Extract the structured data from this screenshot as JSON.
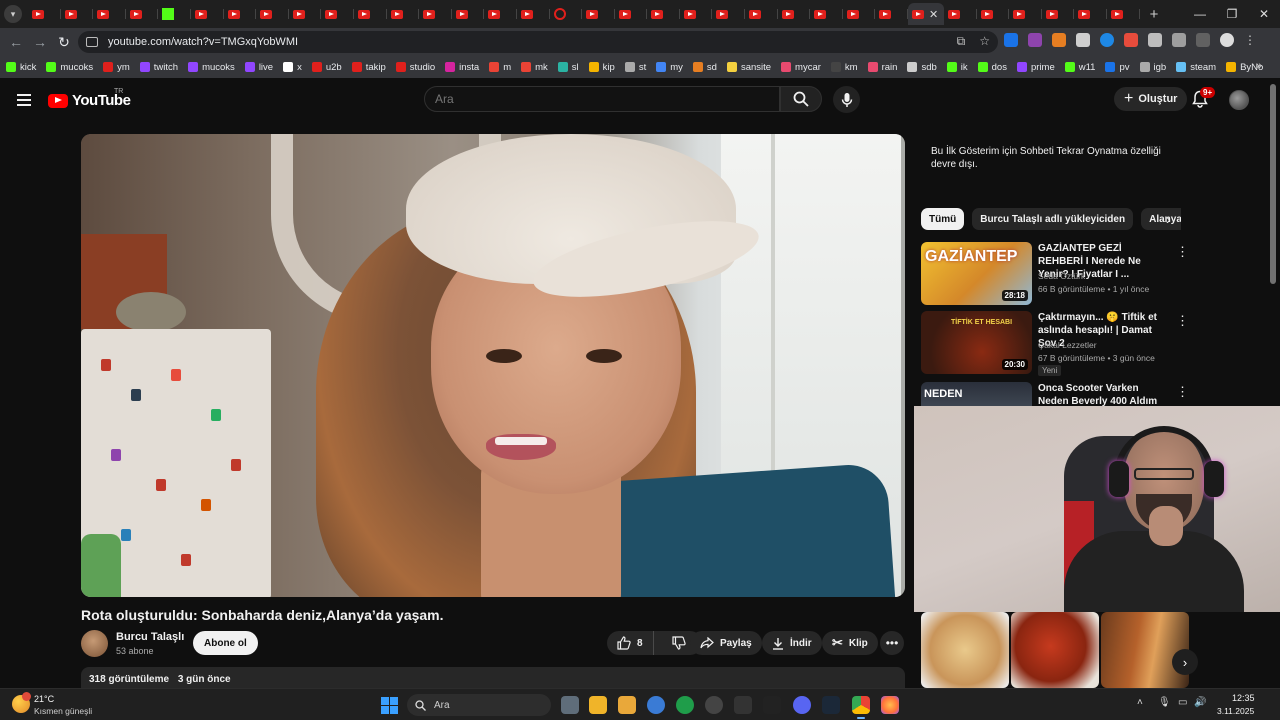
{
  "browser": {
    "url": "youtube.com/watch?v=TMGxqYobWMI",
    "bookmarks": [
      {
        "label": "kick",
        "color": "#53fc18"
      },
      {
        "label": "mucoks",
        "color": "#53fc18"
      },
      {
        "label": "ym",
        "color": "#e0201c"
      },
      {
        "label": "twitch",
        "color": "#9146ff"
      },
      {
        "label": "mucoks",
        "color": "#9146ff"
      },
      {
        "label": "live",
        "color": "#9146ff"
      },
      {
        "label": "x",
        "color": "#ffffff"
      },
      {
        "label": "u2b",
        "color": "#e0201c"
      },
      {
        "label": "takip",
        "color": "#e0201c"
      },
      {
        "label": "studio",
        "color": "#e0201c"
      },
      {
        "label": "insta",
        "color": "#d6249f"
      },
      {
        "label": "m",
        "color": "#ea4335"
      },
      {
        "label": "mk",
        "color": "#ea4335"
      },
      {
        "label": "sl",
        "color": "#2bb3a3"
      },
      {
        "label": "kip",
        "color": "#f4b400"
      },
      {
        "label": "st",
        "color": "#aaaaaa"
      },
      {
        "label": "my",
        "color": "#4285f4"
      },
      {
        "label": "sd",
        "color": "#e67e22"
      },
      {
        "label": "sansite",
        "color": "#f4d03f"
      },
      {
        "label": "mycar",
        "color": "#e84a6f"
      },
      {
        "label": "km",
        "color": "#444444"
      },
      {
        "label": "rain",
        "color": "#e84a6f"
      },
      {
        "label": "sdb",
        "color": "#cccccc"
      },
      {
        "label": "ik",
        "color": "#53fc18"
      },
      {
        "label": "dos",
        "color": "#53fc18"
      },
      {
        "label": "prime",
        "color": "#9146ff"
      },
      {
        "label": "w11",
        "color": "#53fc18"
      },
      {
        "label": "pv",
        "color": "#1a73e8"
      },
      {
        "label": "igb",
        "color": "#aaaaaa"
      },
      {
        "label": "steam",
        "color": "#66c0f4"
      },
      {
        "label": "ByNo",
        "color": "#f4b400"
      }
    ]
  },
  "header": {
    "logo_text": "YouTube",
    "region": "TR",
    "search_placeholder": "Ara",
    "create_label": "Oluştur",
    "notification_count": "9+"
  },
  "video": {
    "title": "Rota oluşturuldu: Sonbaharda deniz,Alanya’da yaşam.",
    "channel": "Burcu Talaşlı",
    "subscribers": "53 abone",
    "subscribe_label": "Abone ol",
    "likes": "8",
    "share_label": "Paylaş",
    "download_label": "İndir",
    "clip_label": "Klip",
    "views": "318 görüntüleme",
    "age": "3 gün önce"
  },
  "sidebar": {
    "chat_notice": "Bu İlk Gösterim için Sohbeti Tekrar Oynatma özelliği devre dışı.",
    "chips": [
      "Tümü",
      "Burcu Talaşlı adlı yükleyiciden",
      "Alanya"
    ],
    "recommendations": [
      {
        "title": "GAZİANTEP GEZİ REHBERİ I Nerede Ne Yenir? I Fiyatlar I ...",
        "channel": "Seda Öztürk",
        "meta": "66 B görüntüleme • 1 yıl önce",
        "duration": "28:18",
        "badge": "",
        "thumb_text": "GAZİANTEP"
      },
      {
        "title": "Çaktırmayın... 🤫 Tiftik et aslında hesaplı! | Damat Şov 2",
        "channel": "Çakal Lezzetler",
        "meta": "67 B görüntüleme • 3 gün önce",
        "duration": "20:30",
        "badge": "Yeni",
        "thumb_text": "TİFTİK ET HESABI"
      },
      {
        "title": "Onca Scooter Varken Neden Beverly 400 Aldım",
        "channel": "",
        "meta": "",
        "duration": "",
        "badge": "",
        "thumb_text": "NEDEN"
      }
    ]
  },
  "taskbar": {
    "temperature": "21°C",
    "weather": "Kısmen güneşli",
    "search_placeholder": "Ara",
    "time": "12:35",
    "date": "3.11.2025"
  }
}
